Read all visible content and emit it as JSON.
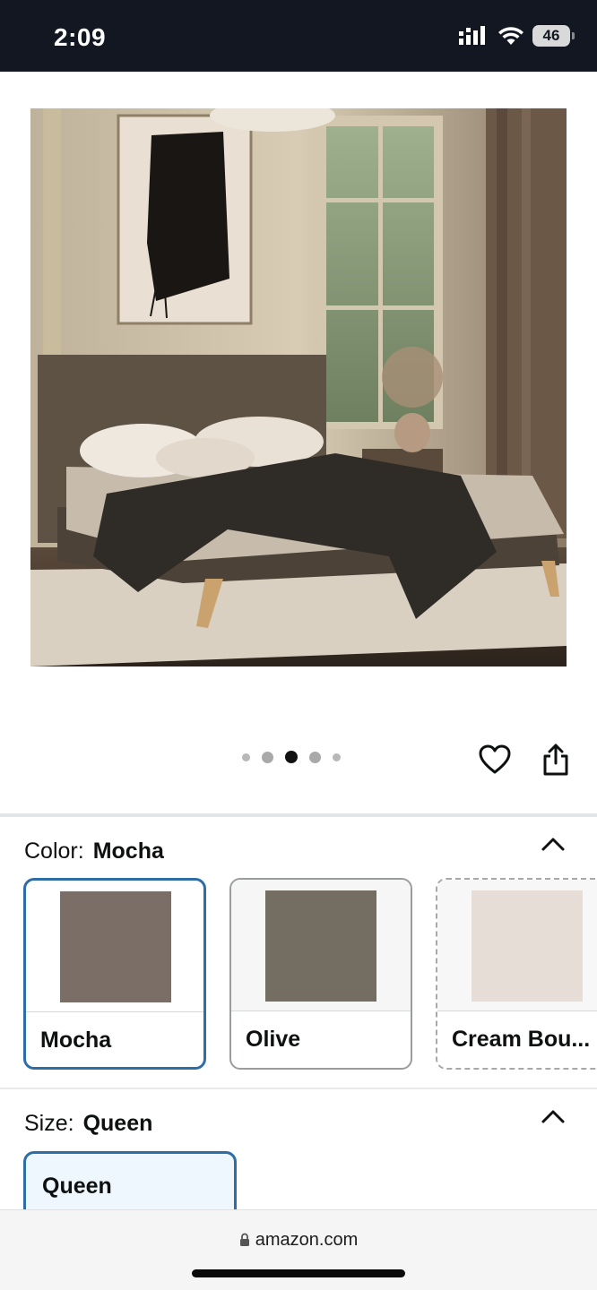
{
  "status_bar": {
    "time": "2:09",
    "battery": "46",
    "icons": [
      "cellular-signal-icon",
      "wifi-icon",
      "battery-icon"
    ]
  },
  "product": {
    "image_alt": "Upholstered platform bed in a bedroom",
    "carousel": {
      "total": 5,
      "active_index": 2
    },
    "actions": [
      "favorite-heart-icon",
      "share-icon"
    ]
  },
  "color": {
    "label": "Color:",
    "selected": "Mocha",
    "options": [
      {
        "name": "Mocha",
        "swatch": "#7b6e66",
        "state": "selected"
      },
      {
        "name": "Olive",
        "swatch": "#736e61",
        "state": "available"
      },
      {
        "name": "Cream Bou...",
        "swatch": "#e6ddd6",
        "state": "unavailable"
      }
    ]
  },
  "size": {
    "label": "Size:",
    "selected": "Queen",
    "options": [
      {
        "name": "Queen",
        "state": "selected"
      }
    ]
  },
  "browser": {
    "url": "amazon.com"
  },
  "colors": {
    "accent": "#2f6ea4",
    "status_bar": "#121722",
    "selected_tile_bg": "#edf7fd"
  }
}
